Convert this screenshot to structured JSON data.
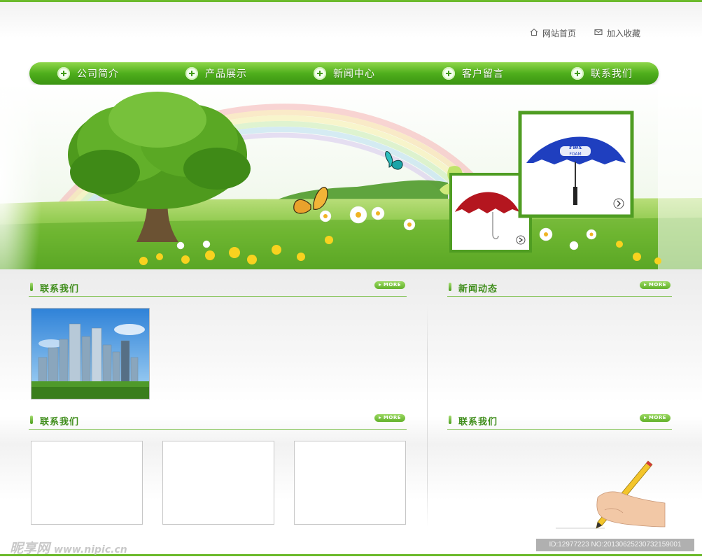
{
  "toplinks": {
    "home": {
      "label": "网站首页",
      "icon": "home-icon"
    },
    "favorite": {
      "label": "加入收藏",
      "icon": "mail-icon"
    }
  },
  "nav": {
    "items": [
      {
        "label": "公司简介",
        "icon": "plus-icon"
      },
      {
        "label": "产品展示",
        "icon": "plus-icon"
      },
      {
        "label": "新闻中心",
        "icon": "plus-icon"
      },
      {
        "label": "客户留言",
        "icon": "plus-icon"
      },
      {
        "label": "联系我们",
        "icon": "plus-icon"
      }
    ]
  },
  "banner": {
    "umbrella_large_text_line1": "Flex",
    "umbrella_large_text_line2": "FOAM"
  },
  "sections": {
    "contact_top": {
      "title": "联系我们",
      "more": "MORE"
    },
    "news": {
      "title": "新闻动态",
      "more": "MORE"
    },
    "contact_bottom": {
      "title": "联系我们",
      "more": "MORE"
    },
    "contact_right": {
      "title": "联系我们",
      "more": "MORE"
    }
  },
  "watermark": {
    "site_cn": "昵享网",
    "site_url": "www.nipic.cn",
    "id_text": "ID:12977223 NO:20130625230732159001"
  },
  "colors": {
    "accent": "#4fae1c",
    "section_title": "#3f8d1b",
    "rule": "#6cba2c"
  }
}
